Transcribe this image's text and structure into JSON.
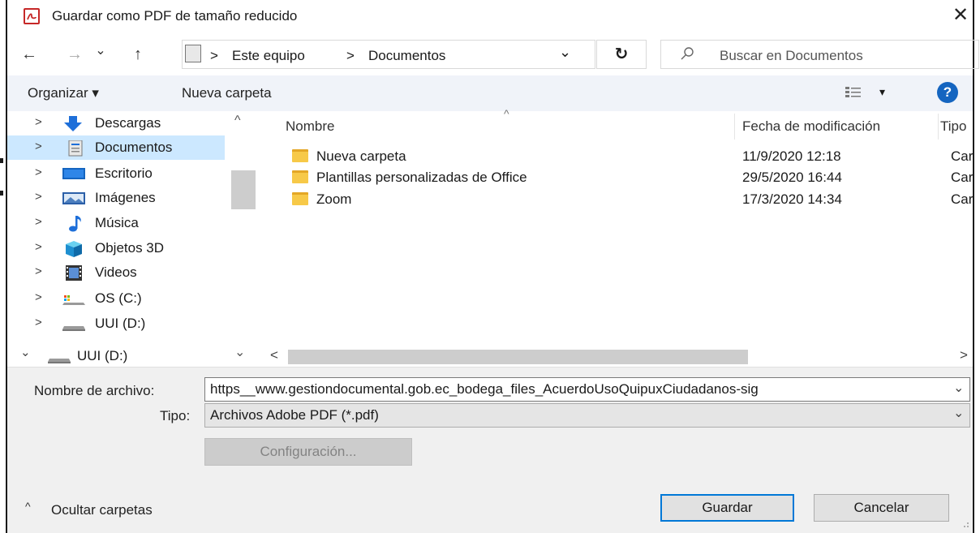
{
  "window": {
    "title": "Guardar como PDF de tamaño reducido",
    "close_glyph": "✕"
  },
  "address_bar": {
    "back_glyph": "←",
    "forward_glyph": "→",
    "recent_glyph": "⌄",
    "up_glyph": "↑",
    "breadcrumb": [
      "Este equipo",
      "Documentos"
    ],
    "separator": ">",
    "dropdown_glyph": "⌄",
    "refresh_glyph": "↻",
    "search_placeholder": "Buscar en Documentos",
    "search_icon": "search-icon"
  },
  "toolbar": {
    "organize_label": "Organizar ▾",
    "new_folder_label": "Nueva carpeta",
    "view_dropdown_glyph": "▾",
    "help_glyph": "?"
  },
  "nav_pane": {
    "items": [
      {
        "label": "Descargas",
        "icon": "downloads-icon",
        "arrow": ">"
      },
      {
        "label": "Documentos",
        "icon": "documents-icon",
        "arrow": ">",
        "selected": true
      },
      {
        "label": "Escritorio",
        "icon": "desktop-icon",
        "arrow": ">"
      },
      {
        "label": "Imágenes",
        "icon": "pictures-icon",
        "arrow": ">"
      },
      {
        "label": "Música",
        "icon": "music-icon",
        "arrow": ">"
      },
      {
        "label": "Objetos 3D",
        "icon": "3d-objects-icon",
        "arrow": ">"
      },
      {
        "label": "Videos",
        "icon": "videos-icon",
        "arrow": ">"
      },
      {
        "label": "OS (C:)",
        "icon": "drive-c-icon",
        "arrow": ">"
      },
      {
        "label": "UUI (D:)",
        "icon": "drive-d-icon",
        "arrow": ">"
      }
    ],
    "expanded_item": {
      "label": "UUI (D:)",
      "icon": "drive-d-icon",
      "arrow": "⌄"
    },
    "scroll_up_glyph": "^",
    "scroll_down_glyph": "⌄"
  },
  "file_list": {
    "columns": {
      "name": "Nombre",
      "modified": "Fecha de modificación",
      "type": "Tipo"
    },
    "sort_glyph": "^",
    "rows": [
      {
        "name": "Nueva carpeta",
        "modified": "11/9/2020 12:18",
        "type": "Carpeta de archivos"
      },
      {
        "name": "Plantillas personalizadas de Office",
        "modified": "29/5/2020 16:44",
        "type": "Carpeta de archivos"
      },
      {
        "name": "Zoom",
        "modified": "17/3/2020 14:34",
        "type": "Carpeta de archivos"
      }
    ],
    "scroll_left_glyph": "<",
    "scroll_right_glyph": ">"
  },
  "save_form": {
    "filename_label": "Nombre de archivo:",
    "filename_value": "https__www.gestiondocumental.gob.ec_bodega_files_AcuerdoUsoQuipuxCiudadanos-sig",
    "type_label": "Tipo:",
    "type_value": "Archivos Adobe PDF (*.pdf)",
    "settings_label": "Configuración...",
    "dropdown_glyph": "⌄"
  },
  "footer": {
    "hide_folders_label": "Ocultar carpetas",
    "hide_folders_glyph": "^",
    "save_label": "Guardar",
    "cancel_label": "Cancelar"
  }
}
